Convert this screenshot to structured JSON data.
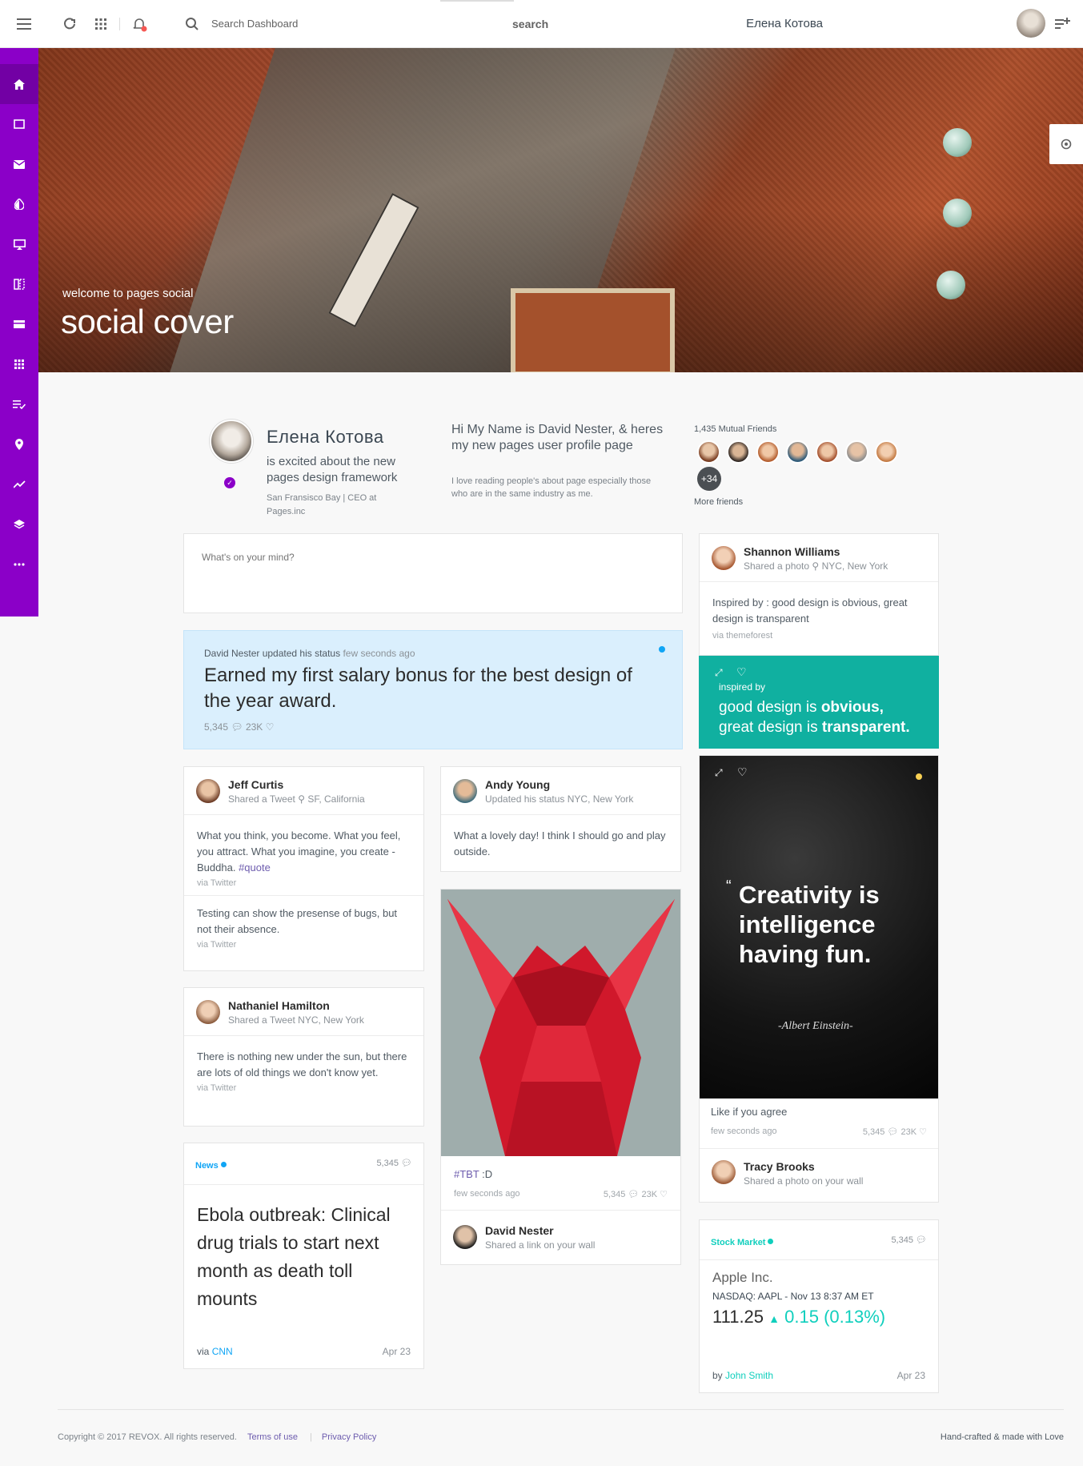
{
  "header": {
    "search_label": "Search Dashboard",
    "search_placeholder": "search",
    "user_name": "Елена Котова"
  },
  "cover": {
    "subtitle": "welcome to pages social",
    "title": "social cover"
  },
  "profile": {
    "name": "Елена Котова",
    "status": "is excited about the new pages design framework",
    "location": "San Fransisco Bay | CEO at Pages.inc",
    "about_title": "Hi My Name is David Nester, & heres my new pages user profile page",
    "about_text": "I love reading people's about page especially those who are in the same industry as me.",
    "mutual_friends": "1,435 Mutual Friends",
    "friends_more": "+34",
    "more_friends_link": "More friends"
  },
  "post": {
    "placeholder": "What's on your mind?"
  },
  "status_card": {
    "author_line": "David Nester updated his status",
    "time": "few seconds ago",
    "text": "Earned my first salary bonus for the best design of the year award.",
    "comments": "5,345",
    "likes": "23K"
  },
  "cards": {
    "jeff": {
      "name": "Jeff Curtis",
      "sub": "Shared a Tweet",
      "location": "SF, California",
      "text": "What you think, you become. What you feel, you attract. What you imagine, you create - Buddha.",
      "hashtag": "#quote",
      "via": "via Twitter",
      "text2": "Testing can show the presense of bugs, but not their absence.",
      "via2": "via Twitter"
    },
    "nathaniel": {
      "name": "Nathaniel Hamilton",
      "sub": "Shared a Tweet NYC, New York",
      "text": "There is nothing new under the sun, but there are lots of old things we don't know yet.",
      "via": "via Twitter"
    },
    "news": {
      "label": "News",
      "count": "5,345",
      "headline": "Ebola outbreak: Clinical drug trials to start next month as death toll mounts",
      "via": "via",
      "source": "CNN",
      "date": "Apr 23"
    },
    "andy": {
      "name": "Andy Young",
      "sub": "Updated his status NYC, New York",
      "text": "What a lovely day! I think I should go and play outside."
    },
    "origami": {
      "tag": "#TBT",
      "caption": " :D",
      "time": "few seconds ago",
      "comments": "5,345",
      "likes": "23K"
    },
    "david": {
      "name": "David Nester",
      "sub": "Shared a link on your wall"
    },
    "shannon": {
      "name": "Shannon Williams",
      "sub": "Shared a photo",
      "location": "NYC, New York",
      "text": "Inspired by : good design is obvious, great design is transparent",
      "via": "via themeforest"
    },
    "teal": {
      "label": "inspired by",
      "line1_a": "good design is ",
      "line1_b": "obvious,",
      "line2_a": "great design is ",
      "line2_b": "transparent."
    },
    "quote": {
      "text": "Creativity is intelligence having fun.",
      "author": "-Albert Einstein-",
      "caption": "Like if you agree",
      "time": "few seconds ago",
      "comments": "5,345",
      "likes": "23K"
    },
    "tracy": {
      "name": "Tracy Brooks",
      "sub": "Shared a photo on your wall"
    },
    "stock": {
      "label": "Stock Market",
      "count": "5,345",
      "company": "Apple Inc.",
      "ticker": "NASDAQ: AAPL - Nov 13 8:37 AM ET",
      "price": "111.25",
      "change": "0.15 (0.13%)",
      "by": "by",
      "author": "John Smith",
      "date": "Apr 23"
    }
  },
  "footer": {
    "copyright": "Copyright © 2017 REVOX. All rights reserved.",
    "terms": "Terms of use",
    "privacy": "Privacy Policy",
    "right": "Hand-crafted & made with Love"
  },
  "colors": {
    "sidebar": "#8b00c8",
    "accent_blue": "#10a5f5",
    "teal": "#10b0a0",
    "stock_green": "#10cfbd",
    "link_purple": "#6d5cae"
  },
  "icons": {
    "header": [
      "menu-icon",
      "refresh-icon",
      "apps-grid-icon",
      "bell-icon",
      "search-icon",
      "add-list-icon"
    ],
    "sidebar": [
      "home-icon",
      "calendar-icon",
      "mail-icon",
      "contrast-icon",
      "monitor-icon",
      "columns-icon",
      "card-icon",
      "grid-icon",
      "checklist-icon",
      "location-icon",
      "trend-icon",
      "layers-icon",
      "more-icon"
    ]
  }
}
